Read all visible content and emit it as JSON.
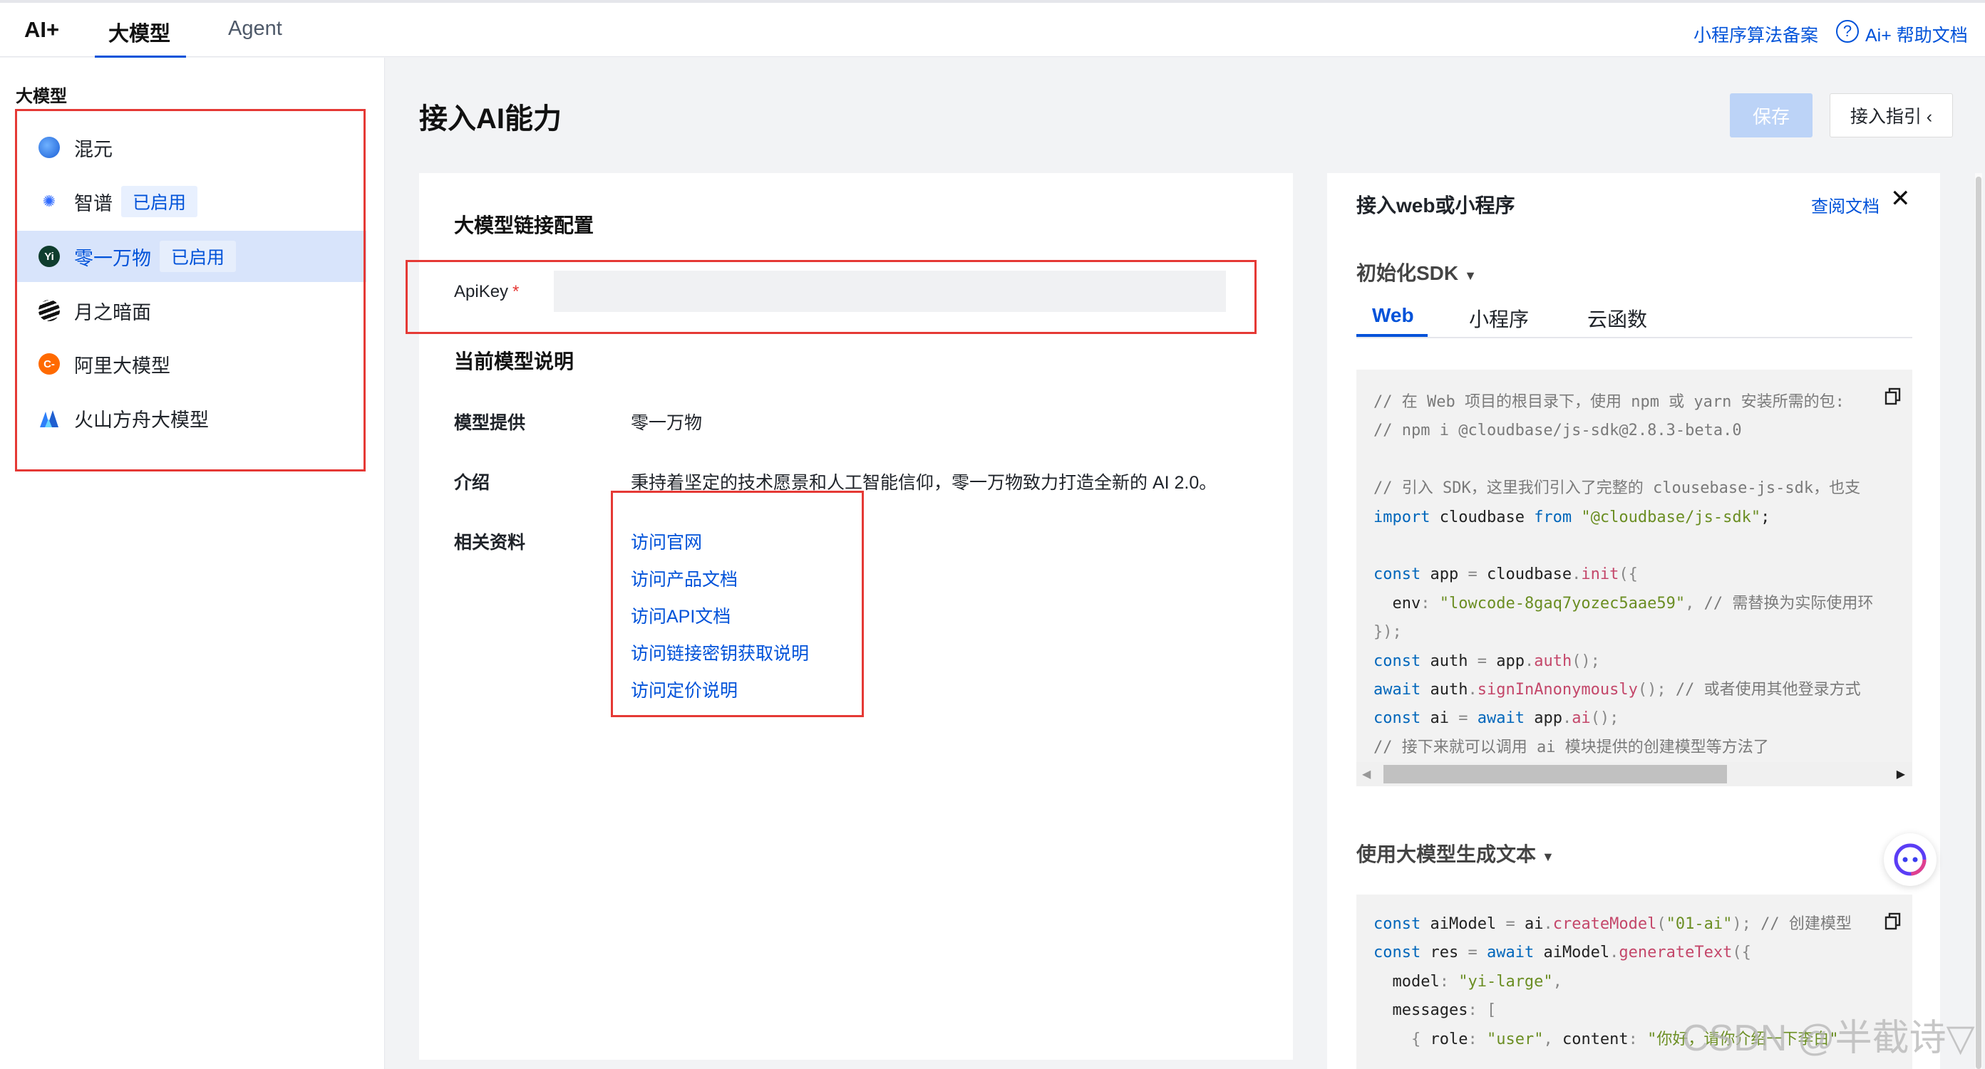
{
  "topbar": {
    "brand": "AI+",
    "tabs": [
      {
        "label": "大模型",
        "active": true
      },
      {
        "label": "Agent",
        "active": false
      }
    ],
    "links": {
      "filing": "小程序算法备案",
      "help": "Ai+ 帮助文档"
    }
  },
  "sidebar": {
    "title": "大模型",
    "items": [
      {
        "label": "混元",
        "badge": "",
        "icon": "hunyuan-icon",
        "selected": false
      },
      {
        "label": "智谱",
        "badge": "已启用",
        "icon": "zhipu-icon",
        "selected": false
      },
      {
        "label": "零一万物",
        "badge": "已启用",
        "icon": "lingyiwanwu-icon",
        "selected": true
      },
      {
        "label": "月之暗面",
        "badge": "",
        "icon": "moonshot-icon",
        "selected": false
      },
      {
        "label": "阿里大模型",
        "badge": "",
        "icon": "aliyun-icon",
        "selected": false
      },
      {
        "label": "火山方舟大模型",
        "badge": "",
        "icon": "volcengine-icon",
        "selected": false
      }
    ]
  },
  "main": {
    "title": "接入AI能力",
    "save_label": "保存",
    "guide_label": "接入指引 ‹",
    "config_title": "大模型链接配置",
    "apikey_label": "ApiKey",
    "apikey_required": "*",
    "apikey_value": "",
    "model_desc_title": "当前模型说明",
    "provider_label": "模型提供",
    "provider_value": "零一万物",
    "intro_label": "介绍",
    "intro_value": "秉持着坚定的技术愿景和人工智能信仰，零一万物致力打造全新的 AI 2.0。",
    "resources_label": "相关资料",
    "resources": [
      "访问官网",
      "访问产品文档",
      "访问API文档",
      "访问链接密钥获取说明",
      "访问定价说明"
    ]
  },
  "right_panel": {
    "title": "接入web或小程序",
    "doc_link": "查阅文档",
    "close_icon": "✕",
    "init_sdk_title": "初始化SDK",
    "tabs": [
      {
        "label": "Web",
        "active": true
      },
      {
        "label": "小程序",
        "active": false
      },
      {
        "label": "云函数",
        "active": false
      }
    ],
    "gen_text_title": "使用大模型生成文本"
  },
  "code_init": [
    [
      [
        "c-cm",
        "// 在 Web 项目的根目录下，使用 npm 或 yarn 安装所需的包:"
      ]
    ],
    [
      [
        "c-cm",
        "// npm i @cloudbase/js-sdk@2.8.3-beta.0"
      ]
    ],
    [],
    [
      [
        "c-cm",
        "// 引入 SDK，这里我们引入了完整的 clousebase-js-sdk，也支"
      ]
    ],
    [
      [
        "c-kw",
        "import"
      ],
      [
        "c-pl",
        " cloudbase "
      ],
      [
        "c-kw",
        "from"
      ],
      [
        "c-pl",
        " "
      ],
      [
        "c-str",
        "\"@cloudbase/js-sdk\""
      ],
      [
        "c-pl",
        ";"
      ]
    ],
    [],
    [
      [
        "c-kw",
        "const"
      ],
      [
        "c-pl",
        " app "
      ],
      [
        "c-op",
        "="
      ],
      [
        "c-pl",
        " cloudbase"
      ],
      [
        "c-op",
        "."
      ],
      [
        "c-fn",
        "init"
      ],
      [
        "c-op",
        "({"
      ]
    ],
    [
      [
        "c-pl",
        "  env"
      ],
      [
        "c-op",
        ": "
      ],
      [
        "c-str",
        "\"lowcode-8gaq7yozec5aae59\""
      ],
      [
        "c-op",
        ", "
      ],
      [
        "c-cm",
        "// 需替换为实际使用环"
      ]
    ],
    [
      [
        "c-op",
        "});"
      ]
    ],
    [
      [
        "c-kw",
        "const"
      ],
      [
        "c-pl",
        " auth "
      ],
      [
        "c-op",
        "="
      ],
      [
        "c-pl",
        " app"
      ],
      [
        "c-op",
        "."
      ],
      [
        "c-fn",
        "auth"
      ],
      [
        "c-op",
        "();"
      ]
    ],
    [
      [
        "c-kw",
        "await"
      ],
      [
        "c-pl",
        " auth"
      ],
      [
        "c-op",
        "."
      ],
      [
        "c-fn",
        "signInAnonymously"
      ],
      [
        "c-op",
        "(); "
      ],
      [
        "c-cm",
        "// 或者使用其他登录方式"
      ]
    ],
    [
      [
        "c-kw",
        "const"
      ],
      [
        "c-pl",
        " ai "
      ],
      [
        "c-op",
        "= "
      ],
      [
        "c-kw",
        "await"
      ],
      [
        "c-pl",
        " app"
      ],
      [
        "c-op",
        "."
      ],
      [
        "c-fn",
        "ai"
      ],
      [
        "c-op",
        "();"
      ]
    ],
    [
      [
        "c-cm",
        "// 接下来就可以调用 ai 模块提供的创建模型等方法了"
      ]
    ]
  ],
  "code_gen": [
    [
      [
        "c-kw",
        "const"
      ],
      [
        "c-pl",
        " aiModel "
      ],
      [
        "c-op",
        "="
      ],
      [
        "c-pl",
        " ai"
      ],
      [
        "c-op",
        "."
      ],
      [
        "c-fn",
        "createModel"
      ],
      [
        "c-op",
        "("
      ],
      [
        "c-str",
        "\"01-ai\""
      ],
      [
        "c-op",
        "); "
      ],
      [
        "c-cm",
        "// 创建模型"
      ]
    ],
    [
      [
        "c-kw",
        "const"
      ],
      [
        "c-pl",
        " res "
      ],
      [
        "c-op",
        "= "
      ],
      [
        "c-kw",
        "await"
      ],
      [
        "c-pl",
        " aiModel"
      ],
      [
        "c-op",
        "."
      ],
      [
        "c-fn",
        "generateText"
      ],
      [
        "c-op",
        "({"
      ]
    ],
    [
      [
        "c-pl",
        "  model"
      ],
      [
        "c-op",
        ": "
      ],
      [
        "c-str",
        "\"yi-large\""
      ],
      [
        "c-op",
        ","
      ]
    ],
    [
      [
        "c-pl",
        "  messages"
      ],
      [
        "c-op",
        ": ["
      ]
    ],
    [
      [
        "c-op",
        "    { "
      ],
      [
        "c-pl",
        "role"
      ],
      [
        "c-op",
        ": "
      ],
      [
        "c-str",
        "\"user\""
      ],
      [
        "c-op",
        ", "
      ],
      [
        "c-pl",
        "content"
      ],
      [
        "c-op",
        ": "
      ],
      [
        "c-str",
        "\"你好，请你介绍一下李白\""
      ]
    ]
  ],
  "watermark": "CSDN @半截诗▽",
  "colors": {
    "accent": "#0052d9",
    "annotation_red": "#e53935",
    "selected_bg": "#d8e4fb"
  }
}
